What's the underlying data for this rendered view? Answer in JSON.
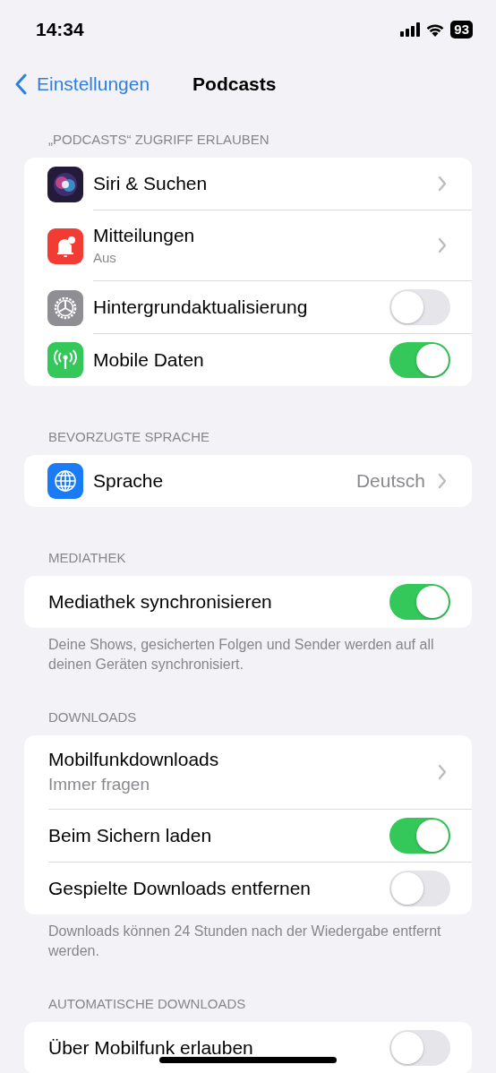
{
  "status_bar": {
    "time": "14:34",
    "battery": "93"
  },
  "nav": {
    "back": "Einstellungen",
    "title": "Podcasts"
  },
  "sections": [
    {
      "header": "„PODCASTS“ ZUGRIFF ERLAUBEN",
      "rows": [
        {
          "kind": "link",
          "label": "Siri & Suchen"
        },
        {
          "kind": "link",
          "label": "Mitteilungen",
          "subtitle": "Aus"
        },
        {
          "kind": "toggle",
          "label": "Hintergrundaktualisierung",
          "on": false
        },
        {
          "kind": "toggle",
          "label": "Mobile Daten",
          "on": true
        }
      ]
    },
    {
      "header": "BEVORZUGTE SPRACHE",
      "rows": [
        {
          "kind": "link",
          "label": "Sprache",
          "value": "Deutsch"
        }
      ]
    },
    {
      "header": "MEDIATHEK",
      "rows": [
        {
          "kind": "toggle",
          "label": "Mediathek synchronisieren",
          "on": true
        }
      ],
      "footer": "Deine Shows, gesicherten Folgen und Sender werden auf all deinen Geräten synchronisiert."
    },
    {
      "header": "DOWNLOADS",
      "rows": [
        {
          "kind": "link",
          "label": "Mobilfunkdownloads",
          "subtitle": "Immer fragen"
        },
        {
          "kind": "toggle",
          "label": "Beim Sichern laden",
          "on": true
        },
        {
          "kind": "toggle",
          "label": "Gespielte Downloads entfernen",
          "on": false
        }
      ],
      "footer": "Downloads können 24 Stunden nach der Wiedergabe entfernt werden."
    },
    {
      "header": "AUTOMATISCHE DOWNLOADS",
      "rows": [
        {
          "kind": "toggle",
          "label": "Über Mobilfunk erlauben",
          "on": false
        }
      ]
    }
  ]
}
